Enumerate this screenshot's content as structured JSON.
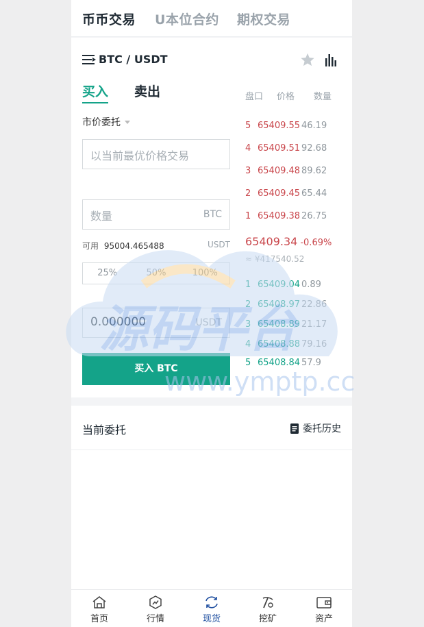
{
  "top_tabs": [
    "币币交易",
    "U本位合约",
    "期权交易"
  ],
  "pair": "BTC / USDT",
  "side_tabs": {
    "buy": "买入",
    "sell": "卖出"
  },
  "orderbook_headers": {
    "depth": "盘口",
    "price": "价格",
    "qty": "数量"
  },
  "order_type": "市价委托",
  "price_placeholder": "以当前最优价格交易",
  "amount": {
    "placeholder": "数量",
    "unit": "BTC"
  },
  "available": {
    "label": "可用",
    "value": "95004.465488",
    "unit": "USDT"
  },
  "percent_options": [
    "25%",
    "50%",
    "100%"
  ],
  "total": {
    "value": "0.000000",
    "unit": "USDT"
  },
  "buy_button": "买入 BTC",
  "asks": [
    {
      "idx": "5",
      "price": "65409.55",
      "qty": "46.19"
    },
    {
      "idx": "4",
      "price": "65409.51",
      "qty": "92.68"
    },
    {
      "idx": "3",
      "price": "65409.48",
      "qty": "89.62"
    },
    {
      "idx": "2",
      "price": "65409.45",
      "qty": "65.44"
    },
    {
      "idx": "1",
      "price": "65409.38",
      "qty": "26.75"
    }
  ],
  "last_price": {
    "price": "65409.34",
    "change": "-0.69%",
    "cny": "≈ ¥417540.52"
  },
  "bids": [
    {
      "idx": "1",
      "price": "65409.04",
      "qty": "0.89"
    },
    {
      "idx": "2",
      "price": "65408.97",
      "qty": "22.86"
    },
    {
      "idx": "3",
      "price": "65408.89",
      "qty": "21.17"
    },
    {
      "idx": "4",
      "price": "65408.88",
      "qty": "79.16"
    },
    {
      "idx": "5",
      "price": "65408.84",
      "qty": "57.9"
    }
  ],
  "current_orders": {
    "title": "当前委托",
    "history": "委托历史"
  },
  "bottom_nav": [
    "首页",
    "行情",
    "现货",
    "挖矿",
    "资产"
  ],
  "watermark": {
    "text": "源码平台",
    "url": "www.ymptp.cc"
  },
  "colors": {
    "accent": "#14a389",
    "ask": "#c9464b",
    "nav_active": "#1f4fa0"
  }
}
